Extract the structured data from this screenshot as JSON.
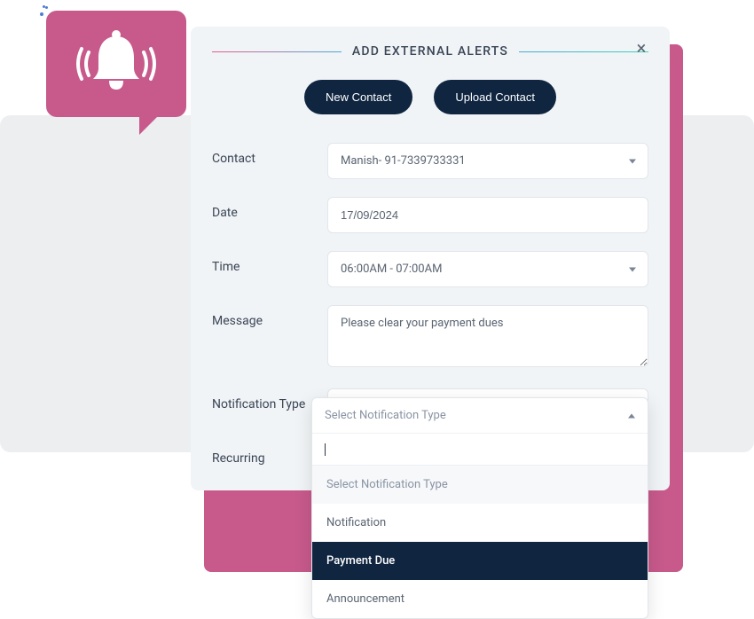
{
  "modal": {
    "title": "ADD EXTERNAL ALERTS",
    "actions": {
      "new_contact": "New Contact",
      "upload_contact": "Upload Contact"
    }
  },
  "form": {
    "contact": {
      "label": "Contact",
      "value": "Manish- 91-7339733331"
    },
    "date": {
      "label": "Date",
      "value": "17/09/2024"
    },
    "time": {
      "label": "Time",
      "value": "06:00AM - 07:00AM"
    },
    "message": {
      "label": "Message",
      "value": "Please clear your payment dues"
    },
    "notification_type": {
      "label": "Notification Type",
      "placeholder": "Select Notification Type"
    },
    "recurring": {
      "label": "Recurring"
    }
  },
  "dropdown": {
    "options": [
      {
        "label": "Select Notification Type",
        "state": "muted"
      },
      {
        "label": "Notification",
        "state": "normal"
      },
      {
        "label": "Payment Due",
        "state": "selected"
      },
      {
        "label": "Announcement",
        "state": "normal"
      }
    ]
  },
  "colors": {
    "accent_pink": "#c75a8b",
    "dark_navy": "#0f2540",
    "panel_bg": "#f1f4f6"
  }
}
